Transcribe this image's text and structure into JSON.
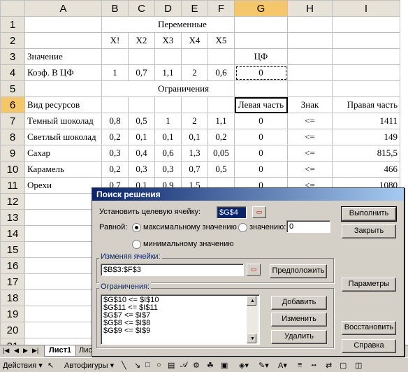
{
  "columns": [
    "A",
    "B",
    "C",
    "D",
    "E",
    "F",
    "G",
    "H",
    "I"
  ],
  "rows": [
    "1",
    "2",
    "3",
    "4",
    "5",
    "6",
    "7",
    "8",
    "9",
    "10",
    "11",
    "12",
    "13",
    "14",
    "15",
    "16",
    "17",
    "18",
    "19",
    "20",
    "21"
  ],
  "cells": {
    "r1": {
      "title": "Переменные"
    },
    "r2": {
      "B": "X!",
      "C": "X2",
      "D": "X3",
      "E": "X4",
      "F": "X5"
    },
    "r3": {
      "A": "Значение",
      "G": "ЦФ"
    },
    "r4": {
      "A": "Коэф. В ЦФ",
      "B": "1",
      "C": "0,7",
      "D": "1,1",
      "E": "2",
      "F": "0,6",
      "G": "0"
    },
    "r5": {
      "title": "Ограничения"
    },
    "r6": {
      "A": "Вид ресурсов",
      "G": "Левая часть",
      "H": "Знак",
      "I": "Правая часть"
    },
    "r7": {
      "A": "Темный шоколад",
      "B": "0,8",
      "C": "0,5",
      "D": "1",
      "E": "2",
      "F": "1,1",
      "G": "0",
      "H": "<=",
      "I": "1411"
    },
    "r8": {
      "A": "Светлый шоколад",
      "B": "0,2",
      "C": "0,1",
      "D": "0,1",
      "E": "0,1",
      "F": "0,2",
      "G": "0",
      "H": "<=",
      "I": "149"
    },
    "r9": {
      "A": "Сахар",
      "B": "0,3",
      "C": "0,4",
      "D": "0,6",
      "E": "1,3",
      "F": "0,05",
      "G": "0",
      "H": "<=",
      "I": "815,5"
    },
    "r10": {
      "A": "Карамель",
      "B": "0,2",
      "C": "0,3",
      "D": "0,3",
      "E": "0,7",
      "F": "0,5",
      "G": "0",
      "H": "<=",
      "I": "466"
    },
    "r11": {
      "A": "Орехи",
      "B": "0,7",
      "C": "0,1",
      "D": "0,9",
      "E": "1,5",
      "F": "",
      "G": "0",
      "H": "<=",
      "I": "1080"
    }
  },
  "sheet_tabs": {
    "active": "Лист1",
    "next": "Лис"
  },
  "drawbar": {
    "actions": "Действия ▾",
    "autoshapes": "Автофигуры ▾"
  },
  "dialog": {
    "title": "Поиск решения",
    "target_label": "Установить целевую ячейку:",
    "target_value": "$G$4",
    "equal_label": "Равной:",
    "opt_max": "максимальному значению",
    "opt_value": "значению:",
    "opt_value_input": "0",
    "opt_min": "минимальному значению",
    "changing_label": "Изменяя ячейки:",
    "changing_value": "$B$3:$F$3",
    "constraints_label": "Ограничения:",
    "constraints": [
      "$G$10 <= $I$10",
      "$G$11 <= $I$11",
      "$G$7 <= $I$7",
      "$G$8 <= $I$8",
      "$G$9 <= $I$9"
    ],
    "buttons": {
      "solve": "Выполнить",
      "close": "Закрыть",
      "guess": "Предположить",
      "options": "Параметры",
      "add": "Добавить",
      "change": "Изменить",
      "delete": "Удалить",
      "reset": "Восстановить",
      "help": "Справка"
    }
  }
}
